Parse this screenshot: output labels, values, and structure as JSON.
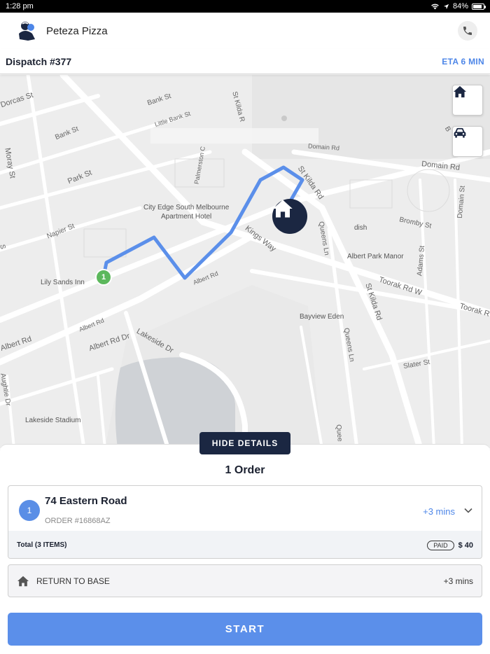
{
  "status_bar": {
    "time": "1:28 pm",
    "battery": "84%",
    "battery_level": 0.84
  },
  "header": {
    "brand_name": "Peteza Pizza",
    "logo_icon": "peteza-logo-icon",
    "phone_icon": "phone-icon"
  },
  "dispatch": {
    "title": "Dispatch #377",
    "eta": "ETA 6 MIN"
  },
  "map": {
    "controls": [
      {
        "icon": "home-icon"
      },
      {
        "icon": "car-icon"
      }
    ],
    "labels": {
      "dorcas_st": "Dorcas St",
      "bank_st_1": "Bank St",
      "bank_st_2": "Bank St",
      "little_bank_st": "Little Bank St",
      "st_kilda_rd_top": "St Kilda R",
      "domain_rd_1": "Domain Rd",
      "domain_rd_2": "Domain Rd",
      "moray_st": "Moray St",
      "park_st": "Park St",
      "palmerston_c": "Palmerston C",
      "city_edge": "City Edge South Melbourne",
      "city_edge_2": "Apartment Hotel",
      "napier_st": "Napier St",
      "kings_way": "Kings Way",
      "st_kilda_rd_mid": "St Kilda Rd",
      "queens_ln_1": "Queens Ln",
      "bromby_st": "Bromby St",
      "domain_st": "Domain St",
      "adams_st": "Adams St",
      "albert_park_manor": "Albert Park Manor",
      "dish": "dish",
      "lily_sands": "Lily Sands Inn",
      "albert_rd_1": "Albert Rd",
      "albert_rd_2": "Albert Rd",
      "albert_rd_3": "Albert Rd",
      "albert_rd_dr": "Albert Rd Dr",
      "st_kilda_rd_low": "St Kilda Rd",
      "toorak_rd_w": "Toorak Rd W",
      "toorak_rd": "Toorak R",
      "bayview_eden": "Bayview Eden",
      "queens_ln_2": "Queens Ln",
      "lakeside_dr": "Lakeside Dr",
      "slater_st": "Slater St",
      "aughtie_dr": "Aughtie Dr",
      "lakeside_stadium": "Lakeside Stadium",
      "queens_low": "Quee",
      "b_label": "B",
      "st_kilda_mid_2": "St Kilda R",
      "s_label": "S"
    },
    "pin_number": "1",
    "destination_icon": "home-marker-icon"
  },
  "details": {
    "toggle_label": "HIDE DETAILS",
    "orders_title": "1 Order",
    "order": {
      "number": "1",
      "address": "74 Eastern Road",
      "order_id": "ORDER #16868AZ",
      "added_time": "+3 mins",
      "total_label": "Total (3 ITEMS)",
      "status": "PAID",
      "amount": "$ 40"
    },
    "return": {
      "label": "RETURN TO BASE",
      "added_time": "+3 mins"
    },
    "start_label": "START"
  },
  "colors": {
    "accent": "#4d86e8",
    "navy": "#1b2742",
    "route": "#5b8fea",
    "pin": "#5cb85c"
  }
}
